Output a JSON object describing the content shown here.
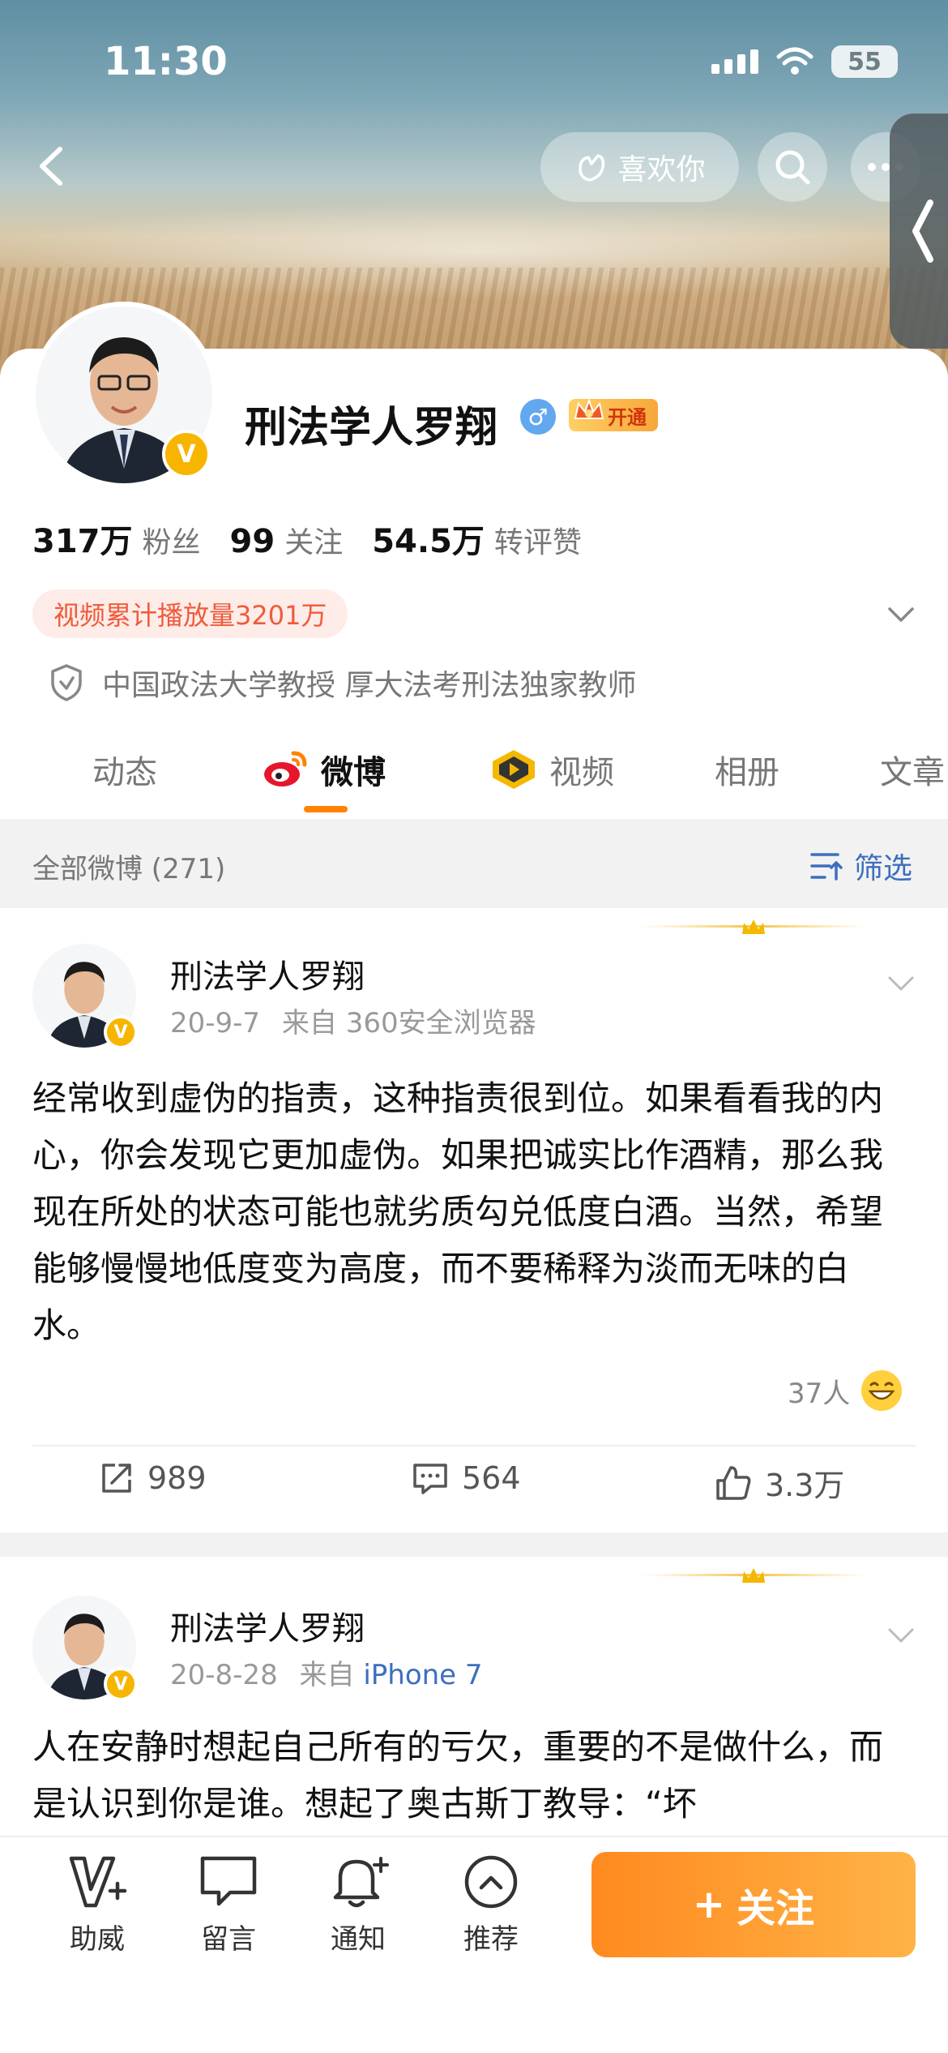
{
  "status_bar": {
    "time": "11:30",
    "battery": "55"
  },
  "header": {
    "like_label": "喜欢你"
  },
  "profile": {
    "name": "刑法学人罗翔",
    "gender_symbol": "♂",
    "vip_label": "开通",
    "badge": "V",
    "stats": [
      {
        "value": "317万",
        "label": "粉丝"
      },
      {
        "value": "99",
        "label": "关注"
      },
      {
        "value": "54.5万",
        "label": "转评赞"
      }
    ],
    "video_plays": "视频累计播放量3201万",
    "certification": "中国政法大学教授 厚大法考刑法独家教师"
  },
  "tabs": [
    {
      "label": "动态",
      "icon": ""
    },
    {
      "label": "微博",
      "icon": "weibo-icon"
    },
    {
      "label": "视频",
      "icon": "video-badge-icon"
    },
    {
      "label": "相册",
      "icon": ""
    },
    {
      "label": "文章",
      "icon": ""
    }
  ],
  "feed": {
    "all_count": "全部微博 (271)",
    "filter_label": "筛选"
  },
  "posts": [
    {
      "author": "刑法学人罗翔",
      "date": "20-9-7",
      "source_prefix": "来自",
      "source": "360安全浏览器",
      "text": "经常收到虚伪的指责，这种指责很到位。如果看看我的内心，你会发现它更加虚伪。如果把诚实比作酒精，那么我现在所处的状态可能也就劣质勾兑低度白酒。当然，希望能够慢慢地低度变为高度，而不要稀释为淡而无味的白水。",
      "reaction_count": "37人",
      "reposts": "989",
      "comments": "564",
      "likes": "3.3万"
    },
    {
      "author": "刑法学人罗翔",
      "date": "20-8-28",
      "source_prefix": "来自",
      "source": "iPhone 7",
      "text": "人在安静时想起自己所有的亏欠，重要的不是做什么，而是认识到你是谁。想起了奥古斯丁教导：“坏"
    }
  ],
  "bottom_bar": {
    "items": [
      {
        "label": "助威",
        "icon": "cheer-icon"
      },
      {
        "label": "留言",
        "icon": "message-icon"
      },
      {
        "label": "通知",
        "icon": "bell-plus-icon"
      },
      {
        "label": "推荐",
        "icon": "chevron-up-circle-icon"
      }
    ],
    "follow_plus": "+",
    "follow_label": "关注"
  },
  "colors": {
    "accent": "#ff8200",
    "link": "#3d6ebf",
    "vip_gold": "#f7b500"
  }
}
